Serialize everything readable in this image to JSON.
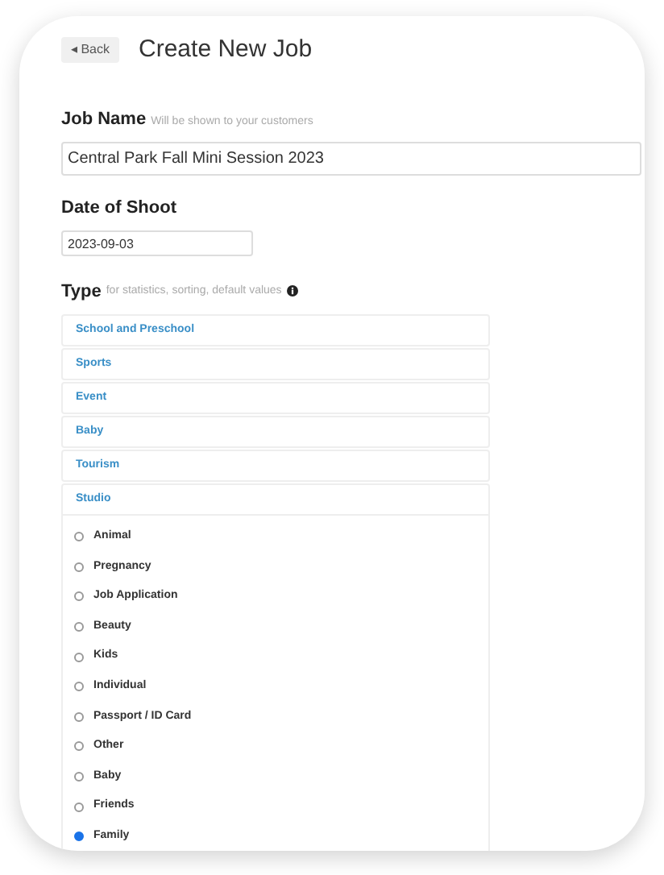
{
  "back_button": {
    "label": "◂ Back"
  },
  "title": "Create New Job",
  "job_name": {
    "label": "Job Name",
    "hint": "Will be shown to your customers",
    "value": "Central Park Fall Mini Session 2023"
  },
  "date_of_shoot": {
    "label": "Date of Shoot",
    "value": "2023-09-03"
  },
  "type": {
    "label": "Type",
    "hint": "for statistics, sorting, default values",
    "categories": [
      {
        "label": "School and Preschool",
        "expanded": false
      },
      {
        "label": "Sports",
        "expanded": false
      },
      {
        "label": "Event",
        "expanded": false
      },
      {
        "label": "Baby",
        "expanded": false
      },
      {
        "label": "Tourism",
        "expanded": false
      },
      {
        "label": "Studio",
        "expanded": true,
        "options": [
          {
            "label": "Animal",
            "selected": false
          },
          {
            "label": "Pregnancy",
            "selected": false
          },
          {
            "label": "Job Application",
            "selected": false
          },
          {
            "label": "Beauty",
            "selected": false
          },
          {
            "label": "Kids",
            "selected": false
          },
          {
            "label": "Individual",
            "selected": false
          },
          {
            "label": "Passport / ID Card",
            "selected": false
          },
          {
            "label": "Other",
            "selected": false
          },
          {
            "label": "Baby",
            "selected": false
          },
          {
            "label": "Friends",
            "selected": false
          },
          {
            "label": "Family",
            "selected": true
          }
        ]
      }
    ]
  }
}
